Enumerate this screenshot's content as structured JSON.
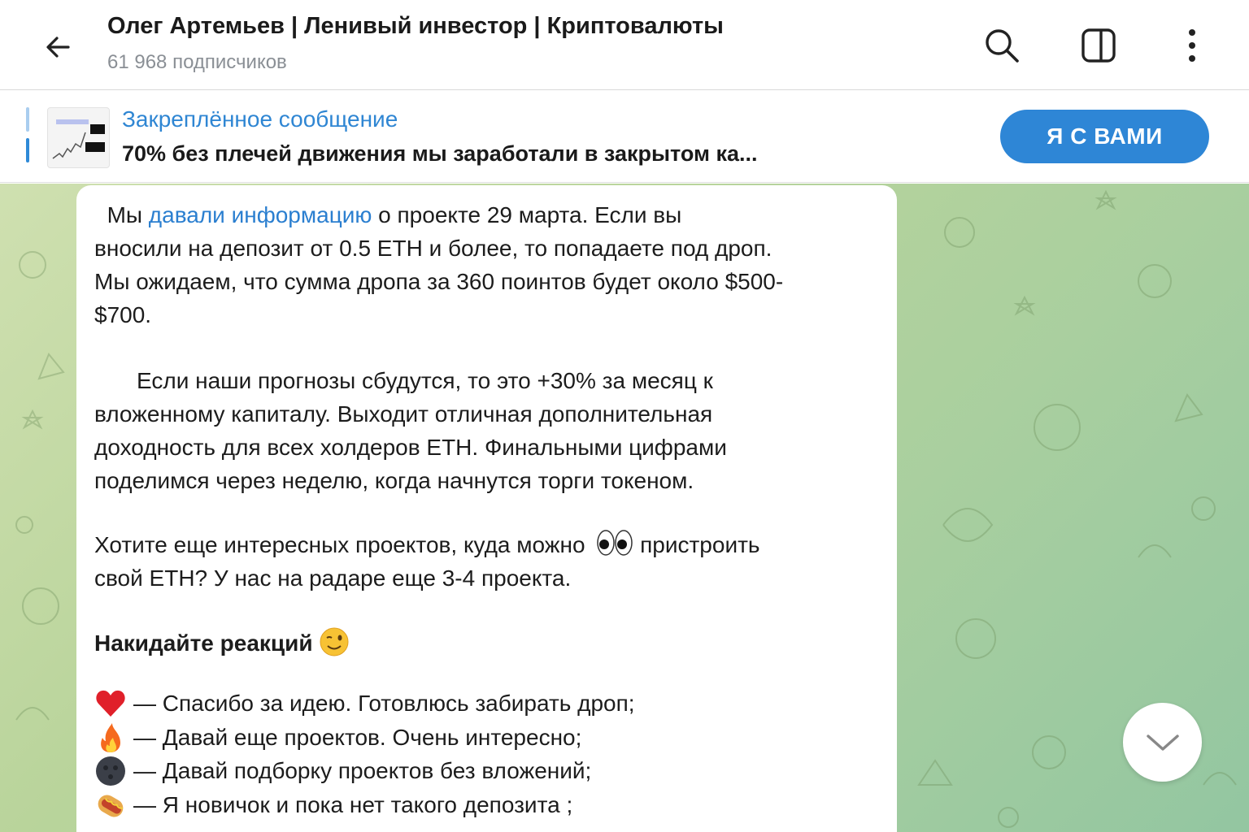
{
  "header": {
    "back_icon": "arrow-left-icon",
    "title": "Олег Артемьев | Ленивый инвестор | Криптовалюты",
    "subtitle": "61 968 подписчиков",
    "icons": [
      "search-icon",
      "sidebar-icon",
      "more-vertical-icon"
    ]
  },
  "pinned": {
    "label": "Закреплённое сообщение",
    "text": "70% без плечей движения мы заработали в закрытом ка...",
    "button": "Я С ВАМИ"
  },
  "message": {
    "p1_pre": "Мы ",
    "p1_link": "давали информацию",
    "p1_post_line1": " о проекте 29 марта. Если вы",
    "p1_line2": "вносили на депозит от 0.5 ETH и более, то попадаете под дроп.",
    "p1_line3": "Мы ожидаем, что сумма дропа за 360 поинтов будет около $500-",
    "p1_line4": "$700.",
    "p2_line1": "Если наши прогнозы сбудутся, то это +30% за месяц к",
    "p2_line2": "вложенному капиталу. Выходит отличная дополнительная",
    "p2_line3": "доходность для всех холдеров ETH. Финальными цифрами",
    "p2_line4": "поделимся через неделю, когда начнутся торги токеном.",
    "p3_line1": "Хотите еще интересных проектов, куда можно",
    "p3_line1_end": " пристроить",
    "p3_line2": "свой ETH? У нас на радаре еще 3-4 проекта.",
    "heading": "Накидайте реакций",
    "reactions": [
      {
        "emoji": "heart-emoji",
        "text": "— Спасибо за идею. Готовлюсь забирать дроп;"
      },
      {
        "emoji": "fire-emoji",
        "text": "— Давай еще проектов. Очень интересно;"
      },
      {
        "emoji": "new-moon-face-emoji",
        "text": "— Давай подборку проектов без вложений;"
      },
      {
        "emoji": "hotdog-emoji",
        "text": "— Я новичок и пока нет такого депозита ;"
      }
    ]
  },
  "scroll_button": "chevron-down-icon",
  "colors": {
    "accent": "#2e86d6",
    "link": "#2b7fd0",
    "chat_bg": "#b9d49b"
  }
}
